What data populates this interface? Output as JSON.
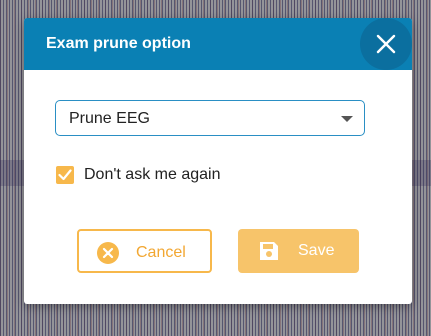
{
  "dialog": {
    "title": "Exam prune option",
    "select": {
      "value": "Prune EEG"
    },
    "checkbox": {
      "label": "Don't ask me again",
      "checked": true
    },
    "buttons": {
      "cancel": "Cancel",
      "save": "Save"
    }
  },
  "colors": {
    "header": "#0a80b4",
    "accent": "#f7b84b",
    "select_border": "#2a8fc4"
  },
  "icons": {
    "close": "close-icon",
    "select_caret": "chevron-down-icon",
    "checkbox": "check-icon",
    "cancel": "cancel-circle-icon",
    "save": "save-icon"
  }
}
